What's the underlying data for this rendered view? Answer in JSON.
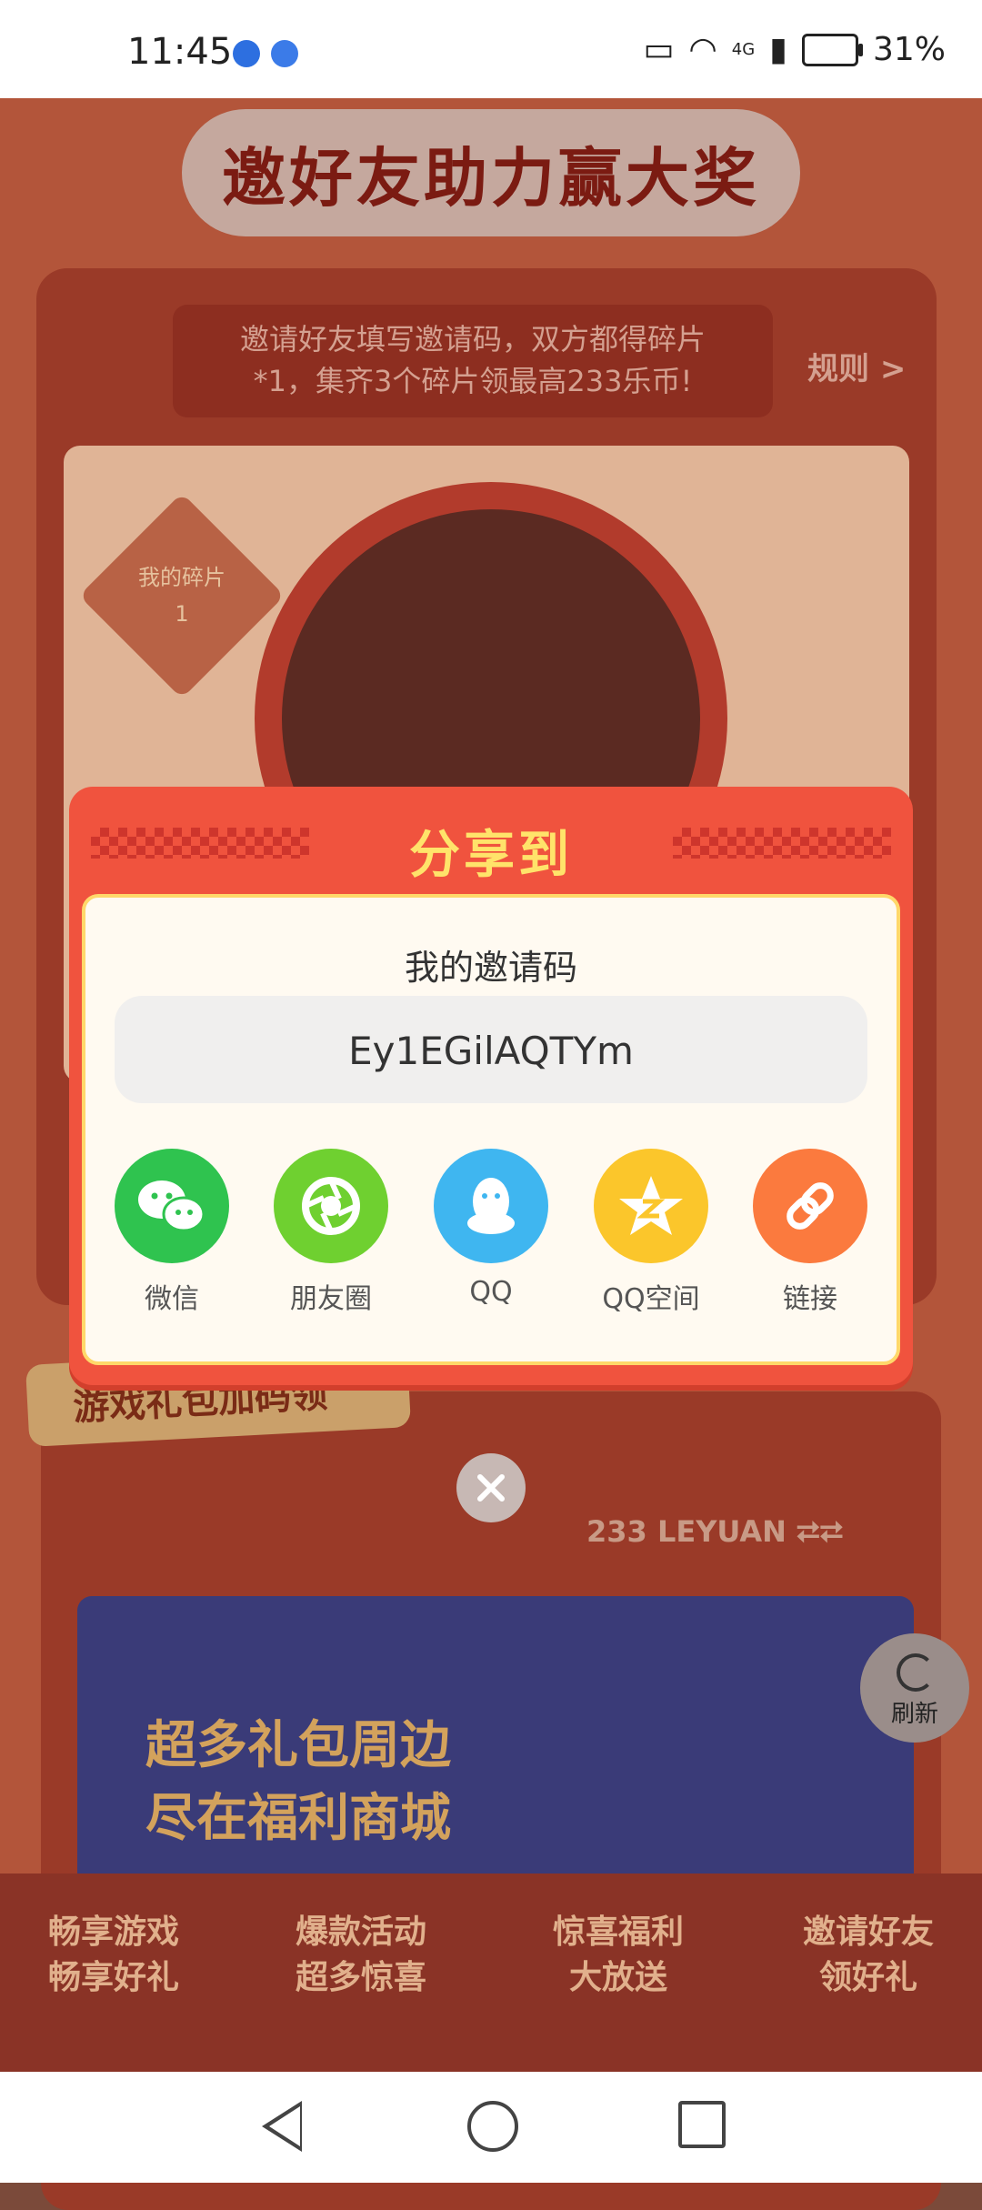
{
  "status_bar": {
    "time": "11:45",
    "battery": "31%",
    "network": "4G"
  },
  "page": {
    "title": "邀好友助力赢大奖",
    "rules_text_line1": "邀请好友填写邀请码，双方都得碎片",
    "rules_text_line2": "*1，集齐3个碎片领最高233乐币!",
    "rules_link": "规则 >",
    "fragments_badge_line1": "我的碎片",
    "fragments_badge_line2": "1",
    "gift_section_title": "游戏礼包加码领",
    "brand": "233 LEYUAN",
    "banner_line1": "超多礼包周边",
    "banner_line2": "尽在福利商城",
    "bottom_captions": [
      {
        "line1": "畅享游戏",
        "line2": "畅享好礼"
      },
      {
        "line1": "爆款活动",
        "line2": "超多惊喜"
      },
      {
        "line1": "惊喜福利",
        "line2": "大放送"
      },
      {
        "line1": "邀请好友",
        "line2": "领好礼"
      }
    ],
    "refresh_label": "刷新"
  },
  "modal": {
    "title": "分享到",
    "code_label": "我的邀请码",
    "invite_code": "Ey1EGilAQTYm",
    "targets": [
      {
        "label": "微信",
        "icon": "wechat-icon",
        "color": "#2fc34f"
      },
      {
        "label": "朋友圈",
        "icon": "moments-icon",
        "color": "#6fd030"
      },
      {
        "label": "QQ",
        "icon": "qq-icon",
        "color": "#3fb6f0"
      },
      {
        "label": "QQ空间",
        "icon": "qzone-icon",
        "color": "#fbc62b"
      },
      {
        "label": "链接",
        "icon": "link-icon",
        "color": "#fb7a3e"
      }
    ]
  }
}
